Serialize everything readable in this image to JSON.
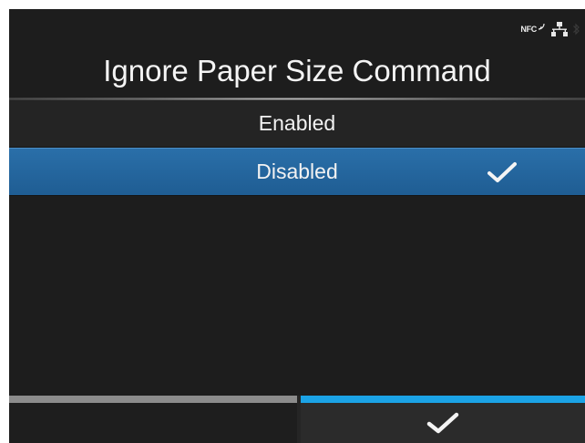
{
  "header": {
    "title": "Ignore Paper Size Command",
    "status_icons": [
      "nfc-icon",
      "network-icon",
      "bluetooth-icon"
    ],
    "nfc_label": "NFC"
  },
  "options": [
    {
      "label": "Enabled",
      "selected": false
    },
    {
      "label": "Disabled",
      "selected": true
    }
  ],
  "softkeys": {
    "left": {
      "icon": "",
      "accent_color": "#8c8c8c"
    },
    "right": {
      "icon": "check-icon",
      "accent_color": "#1ba3e6"
    }
  },
  "colors": {
    "selection": "#2266a0",
    "background": "#1d1d1d"
  }
}
